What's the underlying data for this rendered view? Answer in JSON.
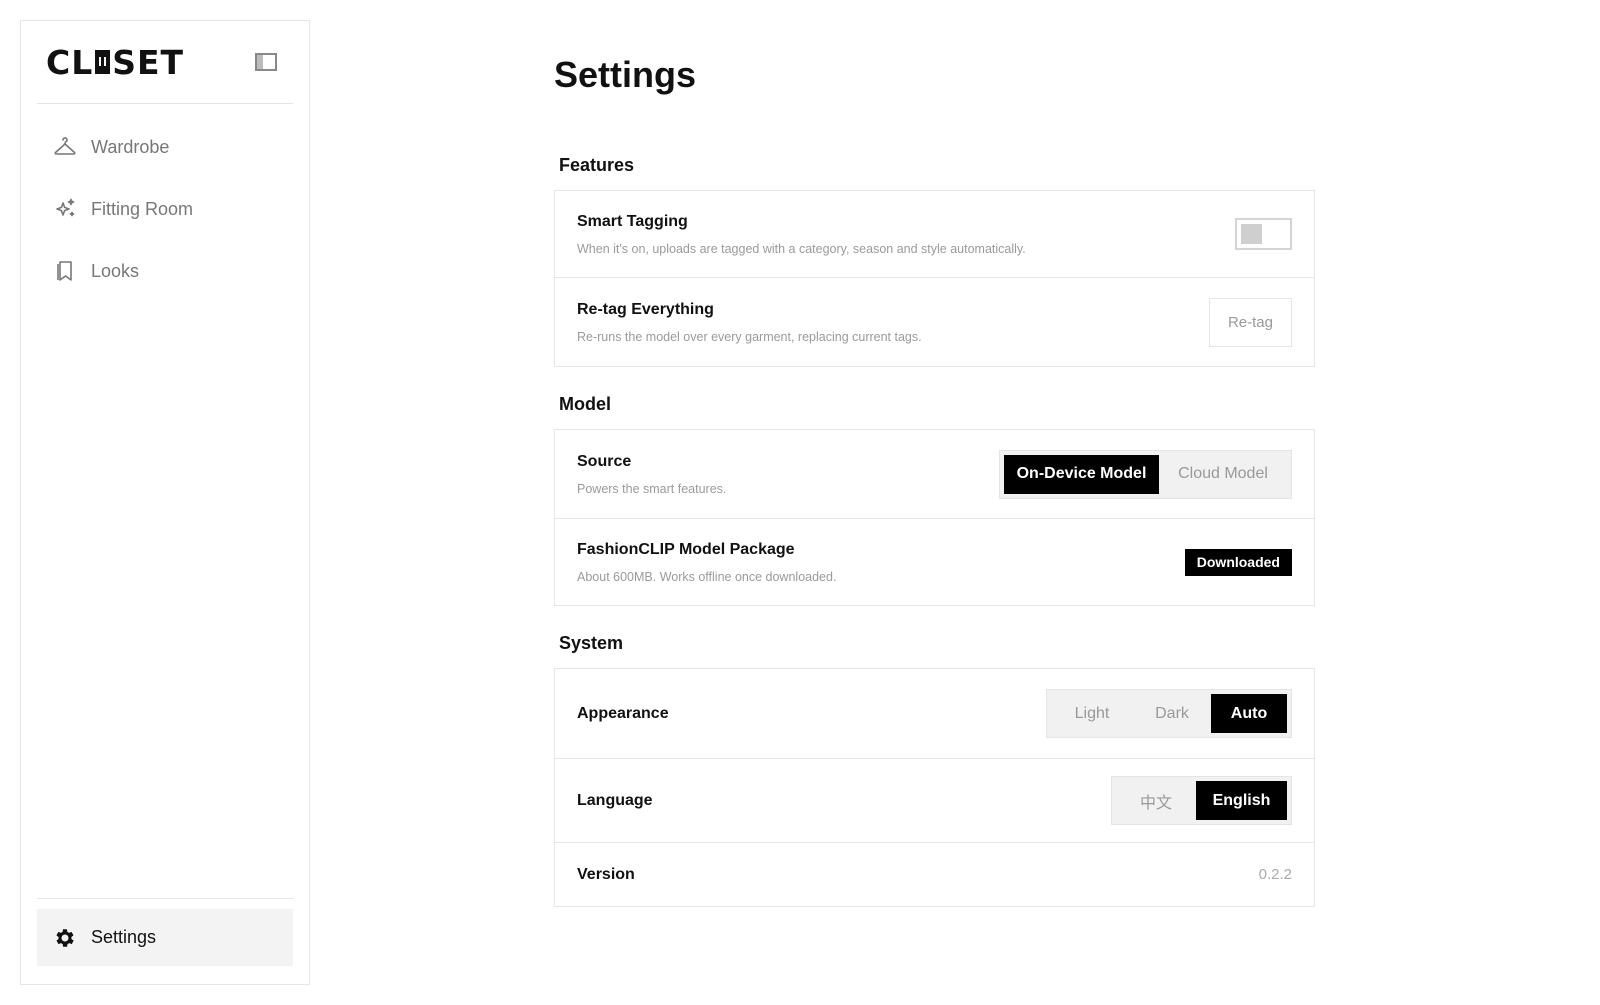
{
  "sidebar": {
    "logo": {
      "before": "CL",
      "after": "SET"
    },
    "nav": [
      {
        "label": "Wardrobe",
        "icon": "hanger-icon"
      },
      {
        "label": "Fitting Room",
        "icon": "sparkle-icon"
      },
      {
        "label": "Looks",
        "icon": "bookmark-icon"
      }
    ],
    "footer": {
      "label": "Settings",
      "icon": "gear-icon"
    }
  },
  "page": {
    "title": "Settings"
  },
  "sections": {
    "features": {
      "label": "Features",
      "smart_tagging": {
        "title": "Smart Tagging",
        "desc": "When it's on, uploads are tagged with a category, season and style automatically.",
        "enabled": false
      },
      "retag": {
        "title": "Re-tag Everything",
        "desc": "Re-runs the model over every garment, replacing current tags.",
        "button": "Re-tag"
      }
    },
    "model": {
      "label": "Model",
      "source": {
        "title": "Source",
        "desc": "Powers the smart features.",
        "options": [
          "On-Device Model",
          "Cloud Model"
        ],
        "selected": "On-Device Model"
      },
      "package": {
        "title": "FashionCLIP Model Package",
        "desc": "About 600MB. Works offline once downloaded.",
        "status": "Downloaded"
      }
    },
    "system": {
      "label": "System",
      "appearance": {
        "title": "Appearance",
        "options": [
          "Light",
          "Dark",
          "Auto"
        ],
        "selected": "Auto"
      },
      "language": {
        "title": "Language",
        "options": [
          "中文",
          "English"
        ],
        "selected": "English"
      },
      "version": {
        "title": "Version",
        "value": "0.2.2"
      }
    }
  },
  "colors": {
    "accent": "#000000",
    "muted": "#999999",
    "border": "#e6e6e6"
  }
}
